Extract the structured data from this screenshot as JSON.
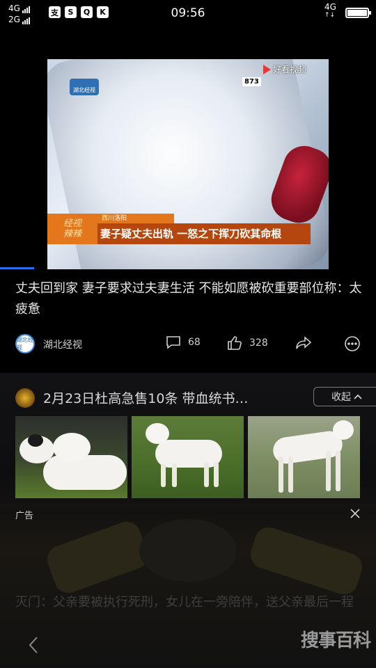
{
  "status_bar": {
    "sim1": "4G",
    "sim2": "2G",
    "app_icons": [
      "支",
      "S",
      "Q",
      "K"
    ],
    "time": "09:56",
    "network_right": "4G"
  },
  "video": {
    "watermark": "好看视频",
    "channel_number": "873",
    "channel_logo_text": "湖北经视",
    "program_tag": "经视\n辣辣",
    "location_tag": "西川洛阳",
    "caption": "妻子疑丈夫出轨 一怒之下挥刀砍其命根",
    "progress": 0.09
  },
  "article": {
    "headline": "丈夫回到家 妻子要求过夫妻生活 不能如愿被砍重要部位称：太疲惫",
    "source_name": "湖北经视",
    "source_avatar_text": "湖北经视",
    "comment_count": "68",
    "like_count": "328"
  },
  "ad": {
    "title": "2月23日杜高急售10条 带血统书…",
    "collapse_label": "收起",
    "ad_label": "广告"
  },
  "next_article": {
    "title": "灭门：父亲要被执行死刑，女儿在一旁陪伴，送父亲最后一程"
  },
  "nav": {
    "brand": "搜事百科"
  },
  "colors": {
    "accent": "#2e6ef0",
    "background": "#000000",
    "caption_bar": "#b5470e",
    "tag_orange": "#e4761b"
  }
}
